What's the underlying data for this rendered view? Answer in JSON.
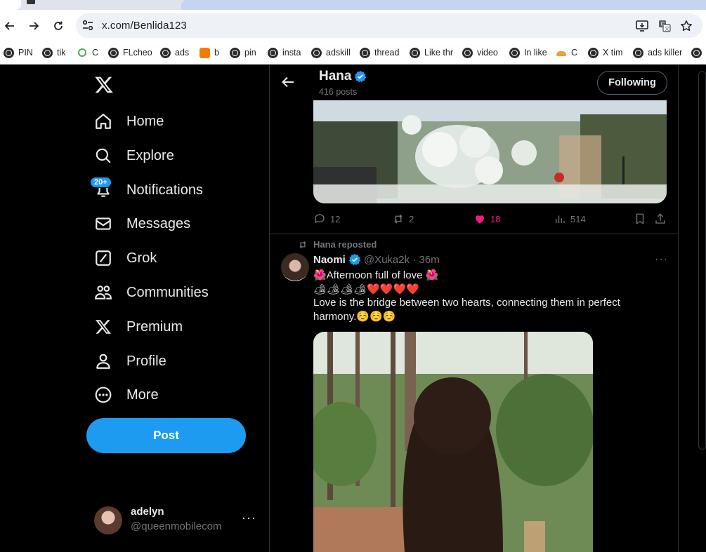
{
  "browser": {
    "url": "x.com/Benlida123",
    "bookmarks": [
      {
        "label": "PIN",
        "icon": "globe-icon"
      },
      {
        "label": "tik",
        "icon": "globe-icon"
      },
      {
        "label": "C",
        "icon": "green-c-icon"
      },
      {
        "label": "FLcheo",
        "icon": "globe-icon"
      },
      {
        "label": "ads",
        "icon": "globe-icon"
      },
      {
        "label": "b",
        "icon": "blogger-icon"
      },
      {
        "label": "pin",
        "icon": "globe-icon"
      },
      {
        "label": "insta",
        "icon": "globe-icon"
      },
      {
        "label": "adskill",
        "icon": "globe-icon"
      },
      {
        "label": "thread",
        "icon": "globe-icon"
      },
      {
        "label": "Like thr",
        "icon": "globe-icon"
      },
      {
        "label": "video",
        "icon": "globe-icon"
      },
      {
        "label": "In like",
        "icon": "globe-icon"
      },
      {
        "label": "C",
        "icon": "orange-cloud-icon"
      },
      {
        "label": "X tim",
        "icon": "globe-icon"
      },
      {
        "label": "ads killer",
        "icon": "globe-icon"
      }
    ]
  },
  "sidebar": {
    "items": [
      {
        "label": "Home",
        "icon": "home-icon"
      },
      {
        "label": "Explore",
        "icon": "search-icon"
      },
      {
        "label": "Notifications",
        "icon": "bell-icon"
      },
      {
        "label": "Messages",
        "icon": "envelope-icon"
      },
      {
        "label": "Grok",
        "icon": "grok-icon"
      },
      {
        "label": "Communities",
        "icon": "communities-icon"
      },
      {
        "label": "Premium",
        "icon": "x-icon"
      },
      {
        "label": "Profile",
        "icon": "person-icon"
      },
      {
        "label": "More",
        "icon": "more-circle-icon"
      }
    ],
    "notifications_badge": "20+",
    "post_label": "Post",
    "account": {
      "name": "adelyn",
      "handle": "@queenmobilecom",
      "more": "···"
    }
  },
  "profile_header": {
    "name": "Hana",
    "posts": "416 posts",
    "follow_label": "Following"
  },
  "first_tweet": {
    "replies": "12",
    "reposts": "2",
    "likes": "18",
    "views": "514",
    "like_color": "#f91880"
  },
  "repost": {
    "label": "Hana reposted",
    "author_name": "Naomi",
    "author_handle": "@Xuka2k · 36m",
    "more": "···",
    "lines": [
      "🌺Afternoon full of love 🌺",
      "🏕🏕🏕🏕❤️❤️❤️❤️",
      "Love is the bridge between two hearts, connecting them in perfect",
      "harmony.☺️☺️☺️"
    ]
  },
  "colors": {
    "accent": "#1d9bf0",
    "background": "#000000",
    "muted": "#71767b",
    "text": "#e7e9ea"
  }
}
